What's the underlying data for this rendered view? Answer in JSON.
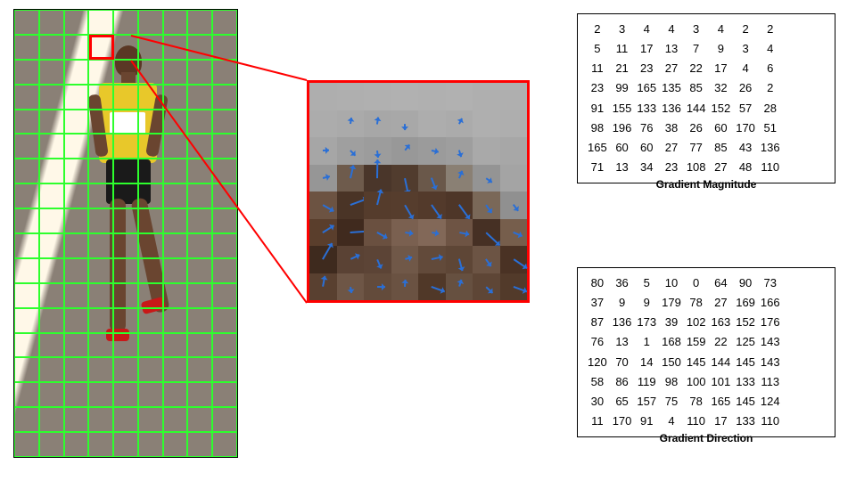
{
  "labels": {
    "magnitude": "Gradient Magnitude",
    "direction": "Gradient Direction"
  },
  "chart_data": {
    "type": "table",
    "title": "HOG gradient patch visualization",
    "grid": {
      "cols": 9,
      "rows": 18
    },
    "highlighted_cell": {
      "col": 3,
      "row": 1
    },
    "zoom_patch_size": 8,
    "gradient_magnitude": [
      [
        2,
        3,
        4,
        4,
        3,
        4,
        2,
        2
      ],
      [
        5,
        11,
        17,
        13,
        7,
        9,
        3,
        4
      ],
      [
        11,
        21,
        23,
        27,
        22,
        17,
        4,
        6
      ],
      [
        23,
        99,
        165,
        135,
        85,
        32,
        26,
        2
      ],
      [
        91,
        155,
        133,
        136,
        144,
        152,
        57,
        28
      ],
      [
        98,
        196,
        76,
        38,
        26,
        60,
        170,
        51
      ],
      [
        165,
        60,
        60,
        27,
        77,
        85,
        43,
        136
      ],
      [
        71,
        13,
        34,
        23,
        108,
        27,
        48,
        110
      ]
    ],
    "gradient_direction": [
      [
        80,
        36,
        5,
        10,
        0,
        64,
        90,
        73
      ],
      [
        37,
        9,
        9,
        179,
        78,
        27,
        169,
        166
      ],
      [
        87,
        136,
        173,
        39,
        102,
        163,
        152,
        176
      ],
      [
        76,
        13,
        1,
        168,
        159,
        22,
        125,
        143
      ],
      [
        120,
        70,
        14,
        150,
        145,
        144,
        145,
        143
      ],
      [
        58,
        86,
        119,
        98,
        100,
        101,
        133,
        113
      ],
      [
        30,
        65,
        157,
        75,
        78,
        165,
        145,
        124
      ],
      [
        11,
        170,
        91,
        4,
        110,
        17,
        133,
        110
      ]
    ],
    "zoom_pixel_colors": [
      [
        "#aeaeae",
        "#afafaf",
        "#b0b0b0",
        "#b1b1b1",
        "#b0b0b0",
        "#b1b1b1",
        "#afafaf",
        "#afafaf"
      ],
      [
        "#acacac",
        "#aaaaaa",
        "#a7a7a7",
        "#a8a8a8",
        "#adadad",
        "#ababab",
        "#afafaf",
        "#aeaeae"
      ],
      [
        "#a6a6a6",
        "#9f9f9f",
        "#9c9c9c",
        "#989898",
        "#9b9b9b",
        "#9e9e9e",
        "#a9a9a9",
        "#a7a7a7"
      ],
      [
        "#969696",
        "#6e5b4c",
        "#4a362a",
        "#513c2e",
        "#6a584a",
        "#8a8074",
        "#949494",
        "#a4a4a4"
      ],
      [
        "#6c5342",
        "#4a3426",
        "#553c2c",
        "#563d2d",
        "#533a2b",
        "#4e3628",
        "#7a6858",
        "#909090"
      ],
      [
        "#5a3e2c",
        "#402a1e",
        "#6a5040",
        "#7a6050",
        "#826858",
        "#6e5444",
        "#463024",
        "#765e4c"
      ],
      [
        "#3e2a1e",
        "#5a4234",
        "#5c4436",
        "#705848",
        "#624a3a",
        "#5e4636",
        "#6c5444",
        "#4a3224"
      ],
      [
        "#594030",
        "#6e5646",
        "#634b3b",
        "#6a5242",
        "#503828",
        "#665040",
        "#5e4636",
        "#523a2a"
      ]
    ]
  }
}
